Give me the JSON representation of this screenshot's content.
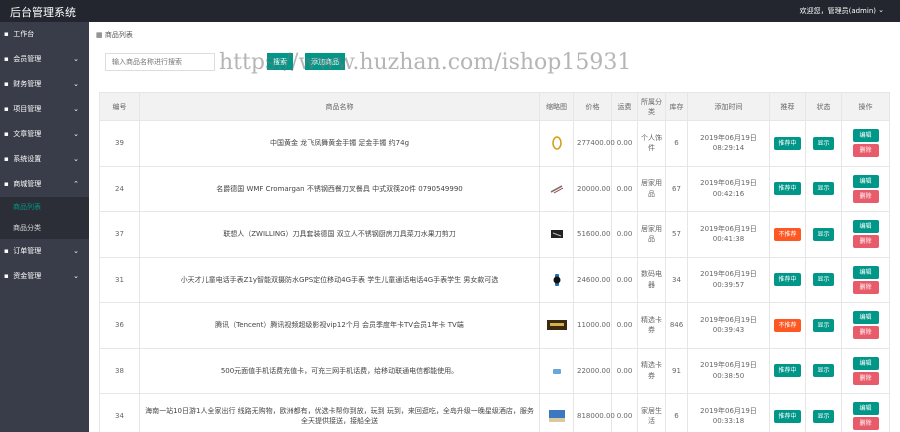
{
  "header": {
    "title": "后台管理系统",
    "user": "欢迎您，管理员(admin)"
  },
  "sidebar": {
    "items": [
      {
        "label": "工作台",
        "expandable": false
      },
      {
        "label": "会员管理",
        "expandable": true
      },
      {
        "label": "财务管理",
        "expandable": true
      },
      {
        "label": "项目管理",
        "expandable": true
      },
      {
        "label": "文章管理",
        "expandable": true
      },
      {
        "label": "系统设置",
        "expandable": true
      },
      {
        "label": "商城管理",
        "expandable": true,
        "expanded": true,
        "children": [
          {
            "label": "商品列表",
            "active": true
          },
          {
            "label": "商品分类",
            "active": false
          }
        ]
      },
      {
        "label": "订单管理",
        "expandable": true
      },
      {
        "label": "资金管理",
        "expandable": true
      }
    ]
  },
  "breadcrumb": "商品列表",
  "search": {
    "placeholder": "输入商品名称进行搜索",
    "button": "搜索",
    "add_button": "添加商品"
  },
  "watermark": "https://www.huzhan.com/ishop15931",
  "table": {
    "headers": [
      "编号",
      "商品名称",
      "缩略图",
      "价格",
      "运费",
      "所属分类",
      "库存",
      "添加时间",
      "推荐",
      "状态",
      "操作"
    ],
    "rows": [
      {
        "id": "39",
        "name": "中国黄金 龙飞凤舞黄金手镯 足金手镯 约74g",
        "thumb": "ring",
        "price": "277400.00",
        "freight": "0.00",
        "category": "个人饰件",
        "stock": "6",
        "time": "2019年06月19日 08:29:14",
        "recommend": "推荐中",
        "status": "显示"
      },
      {
        "id": "24",
        "name": "名爵德国 WMF Cromargan 不锈钢西餐刀叉餐具 中式双筷20件 0790549990",
        "thumb": "knife",
        "price": "20000.00",
        "freight": "0.00",
        "category": "居家用品",
        "stock": "67",
        "time": "2019年06月19日 00:42:16",
        "recommend": "推荐中",
        "status": "显示"
      },
      {
        "id": "37",
        "name": "联想人（ZWILLING）刀具套装德国 双立人不锈钢厨房刀具菜刀水果刀剪刀",
        "thumb": "box",
        "price": "51600.00",
        "freight": "0.00",
        "category": "居家用品",
        "stock": "57",
        "time": "2019年06月19日 00:41:38",
        "recommend": "不推荐",
        "status": "显示"
      },
      {
        "id": "31",
        "name": "小天才儿童电话手表Z1y智能双摄防水GPS定位移动4G手表 学生儿童通话电话4G手表学生 男女款可选",
        "thumb": "watch",
        "price": "24600.00",
        "freight": "0.00",
        "category": "数码电器",
        "stock": "34",
        "time": "2019年06月19日 00:39:57",
        "recommend": "推荐中",
        "status": "显示"
      },
      {
        "id": "36",
        "name": "腾讯（Tencent）腾讯视频超级影视vip12个月 会员季度年卡TV会员1年卡 TV端",
        "thumb": "card",
        "price": "11000.00",
        "freight": "0.00",
        "category": "精选卡券",
        "stock": "846",
        "time": "2019年06月19日 00:39:43",
        "recommend": "不推荐",
        "status": "显示"
      },
      {
        "id": "38",
        "name": "500元面值手机话费充值卡，可充三网手机话费，给移动联通电信都能使用。",
        "thumb": "phonecard",
        "price": "22000.00",
        "freight": "0.00",
        "category": "精选卡券",
        "stock": "91",
        "time": "2019年06月19日 00:38:50",
        "recommend": "推荐中",
        "status": "显示"
      },
      {
        "id": "34",
        "name": "海南一站10日游1人全家出行 线路无购物，欧洲都有，优选卡帮你到放，玩到 玩到，来回逛吃，全岛升级一晚星级酒店，服务全天提供接送，接船全送",
        "thumb": "sea",
        "price": "818000.00",
        "freight": "0.00",
        "category": "家居生活",
        "stock": "6",
        "time": "2019年06月19日 00:33:18",
        "recommend": "推荐中",
        "status": "显示"
      }
    ],
    "actions": {
      "edit": "编辑",
      "delete": "删除"
    }
  },
  "colors": {
    "topbar": "#23262e",
    "sidebar": "#393d49",
    "accent": "#009688",
    "danger": "#e85b6a",
    "off": "#ff5722"
  }
}
